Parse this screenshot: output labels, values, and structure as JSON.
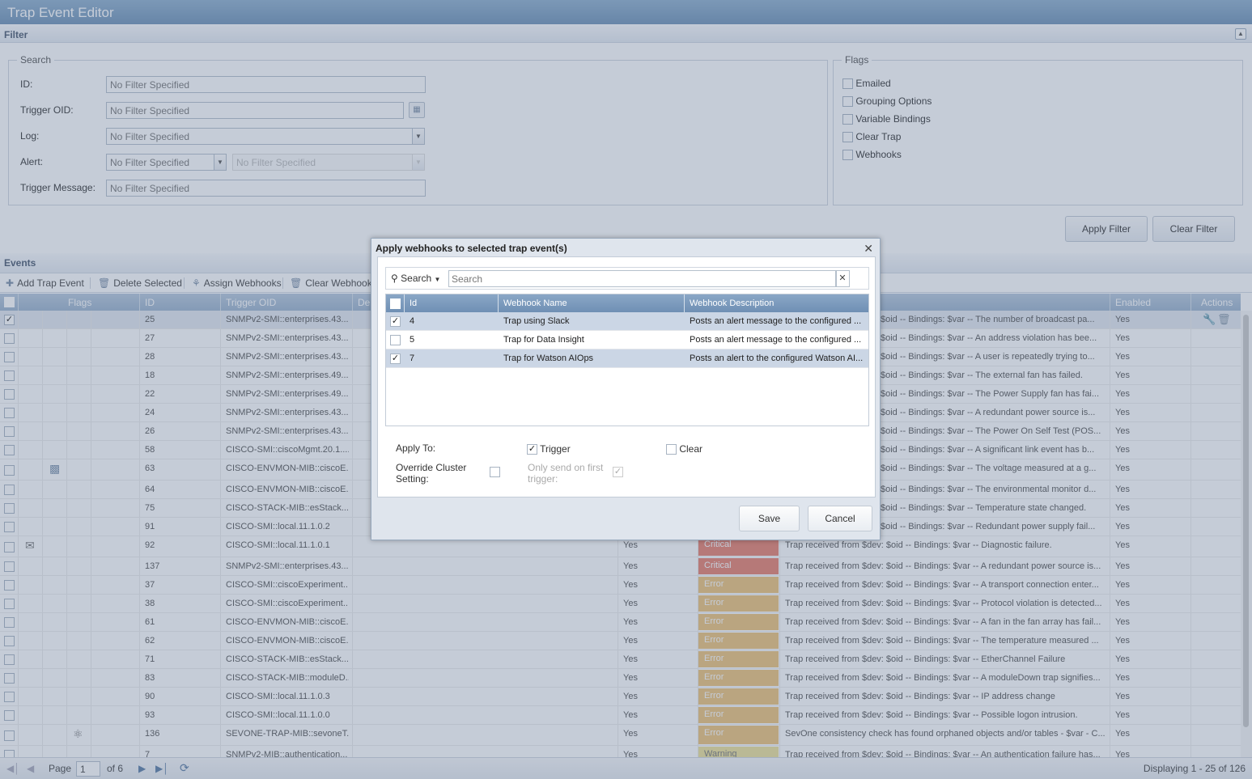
{
  "app": {
    "title": "Trap Event Editor"
  },
  "filter": {
    "title": "Filter",
    "search_legend": "Search",
    "flags_legend": "Flags",
    "fields": [
      {
        "label": "ID:",
        "value": "No Filter Specified"
      },
      {
        "label": "Trigger OID:",
        "value": "No Filter Specified"
      },
      {
        "label": "Log:",
        "value": "No Filter Specified"
      },
      {
        "label": "Alert:",
        "value": "No Filter Specified",
        "value2": "No Filter Specified"
      },
      {
        "label": "Trigger Message:",
        "value": "No Filter Specified"
      }
    ],
    "flags": [
      "Emailed",
      "Grouping Options",
      "Variable Bindings",
      "Clear Trap",
      "Webhooks"
    ],
    "apply_label": "Apply Filter",
    "clear_label": "Clear Filter"
  },
  "events": {
    "title": "Events",
    "toolbar": {
      "add": "Add Trap Event",
      "delete": "Delete Selected",
      "assign": "Assign Webhooks",
      "clear": "Clear Webhooks"
    },
    "columns": {
      "flags": "Flags",
      "id": "ID",
      "oid": "Trigger OID",
      "desc": "De",
      "enabled": "Enabled",
      "actions": "Actions"
    },
    "rows": [
      {
        "id": "25",
        "oid": "SNMPv2-SMI::enterprises.43...",
        "log": "",
        "sev": "",
        "sevclass": "",
        "msg": "$oid -- Bindings: $var -- The number of broadcast pa...",
        "en": "Yes",
        "checked": true,
        "icon": ""
      },
      {
        "id": "27",
        "oid": "SNMPv2-SMI::enterprises.43...",
        "log": "",
        "sev": "",
        "sevclass": "",
        "msg": "$oid -- Bindings: $var -- An address violation has bee...",
        "en": "Yes",
        "checked": false,
        "icon": ""
      },
      {
        "id": "28",
        "oid": "SNMPv2-SMI::enterprises.43...",
        "log": "",
        "sev": "",
        "sevclass": "",
        "msg": "$oid -- Bindings: $var -- A user is repeatedly trying to...",
        "en": "Yes",
        "checked": false,
        "icon": ""
      },
      {
        "id": "18",
        "oid": "SNMPv2-SMI::enterprises.49...",
        "log": "",
        "sev": "",
        "sevclass": "",
        "msg": "$oid -- Bindings: $var -- The external fan has failed.",
        "en": "Yes",
        "checked": false,
        "icon": ""
      },
      {
        "id": "22",
        "oid": "SNMPv2-SMI::enterprises.49...",
        "log": "",
        "sev": "",
        "sevclass": "",
        "msg": "$oid -- Bindings: $var -- The Power Supply fan has fai...",
        "en": "Yes",
        "checked": false,
        "icon": ""
      },
      {
        "id": "24",
        "oid": "SNMPv2-SMI::enterprises.43...",
        "log": "",
        "sev": "",
        "sevclass": "",
        "msg": "$oid -- Bindings: $var -- A redundant power source is...",
        "en": "Yes",
        "checked": false,
        "icon": ""
      },
      {
        "id": "26",
        "oid": "SNMPv2-SMI::enterprises.43...",
        "log": "",
        "sev": "",
        "sevclass": "",
        "msg": "$oid -- Bindings: $var -- The Power On Self Test (POS...",
        "en": "Yes",
        "checked": false,
        "icon": ""
      },
      {
        "id": "58",
        "oid": "CISCO-SMI::ciscoMgmt.20.1....",
        "log": "",
        "sev": "",
        "sevclass": "",
        "msg": "$oid -- Bindings: $var -- A significant link event has b...",
        "en": "Yes",
        "checked": false,
        "icon": ""
      },
      {
        "id": "63",
        "oid": "CISCO-ENVMON-MIB::ciscoE...",
        "log": "",
        "sev": "",
        "sevclass": "",
        "msg": "$oid -- Bindings: $var -- The voltage measured at a g...",
        "en": "Yes",
        "checked": false,
        "icon": "grouping"
      },
      {
        "id": "64",
        "oid": "CISCO-ENVMON-MIB::ciscoE...",
        "log": "",
        "sev": "",
        "sevclass": "",
        "msg": "$oid -- Bindings: $var -- The environmental monitor d...",
        "en": "Yes",
        "checked": false,
        "icon": ""
      },
      {
        "id": "75",
        "oid": "CISCO-STACK-MIB::esStack....",
        "log": "",
        "sev": "",
        "sevclass": "",
        "msg": "$oid -- Bindings: $var -- Temperature state changed.",
        "en": "Yes",
        "checked": false,
        "icon": ""
      },
      {
        "id": "91",
        "oid": "CISCO-SMI::local.11.1.0.2",
        "log": "",
        "sev": "",
        "sevclass": "",
        "msg": "$oid -- Bindings: $var -- Redundant power supply fail...",
        "en": "Yes",
        "checked": false,
        "icon": ""
      },
      {
        "id": "92",
        "oid": "CISCO-SMI::local.11.1.0.1",
        "log": "Yes",
        "sev": "Critical",
        "sevclass": "crit",
        "msg": "Trap received from $dev: $oid -- Bindings: $var -- Diagnostic failure.",
        "en": "Yes",
        "checked": false,
        "icon": "email"
      },
      {
        "id": "137",
        "oid": "SNMPv2-SMI::enterprises.43...",
        "log": "Yes",
        "sev": "Critical",
        "sevclass": "crit",
        "msg": "Trap received from $dev: $oid -- Bindings: $var -- A redundant power source is...",
        "en": "Yes",
        "checked": false,
        "icon": ""
      },
      {
        "id": "37",
        "oid": "CISCO-SMI::ciscoExperiment...",
        "log": "Yes",
        "sev": "Error",
        "sevclass": "err",
        "msg": "Trap received from $dev: $oid -- Bindings: $var -- A transport connection enter...",
        "en": "Yes",
        "checked": false,
        "icon": ""
      },
      {
        "id": "38",
        "oid": "CISCO-SMI::ciscoExperiment...",
        "log": "Yes",
        "sev": "Error",
        "sevclass": "err",
        "msg": "Trap received from $dev: $oid -- Bindings: $var -- Protocol violation is detected...",
        "en": "Yes",
        "checked": false,
        "icon": ""
      },
      {
        "id": "61",
        "oid": "CISCO-ENVMON-MIB::ciscoE...",
        "log": "Yes",
        "sev": "Error",
        "sevclass": "err",
        "msg": "Trap received from $dev: $oid -- Bindings: $var -- A fan in the fan array has fail...",
        "en": "Yes",
        "checked": false,
        "icon": ""
      },
      {
        "id": "62",
        "oid": "CISCO-ENVMON-MIB::ciscoE...",
        "log": "Yes",
        "sev": "Error",
        "sevclass": "err",
        "msg": "Trap received from $dev: $oid -- Bindings: $var -- The temperature measured ...",
        "en": "Yes",
        "checked": false,
        "icon": ""
      },
      {
        "id": "71",
        "oid": "CISCO-STACK-MIB::esStack....",
        "log": "Yes",
        "sev": "Error",
        "sevclass": "err",
        "msg": "Trap received from $dev: $oid -- Bindings: $var -- EtherChannel Failure",
        "en": "Yes",
        "checked": false,
        "icon": ""
      },
      {
        "id": "83",
        "oid": "CISCO-STACK-MIB::moduleD...",
        "log": "Yes",
        "sev": "Error",
        "sevclass": "err",
        "msg": "Trap received from $dev: $oid -- Bindings: $var -- A moduleDown trap signifies...",
        "en": "Yes",
        "checked": false,
        "icon": ""
      },
      {
        "id": "90",
        "oid": "CISCO-SMI::local.11.1.0.3",
        "log": "Yes",
        "sev": "Error",
        "sevclass": "err",
        "msg": "Trap received from $dev: $oid -- Bindings: $var -- IP address change",
        "en": "Yes",
        "checked": false,
        "icon": ""
      },
      {
        "id": "93",
        "oid": "CISCO-SMI::local.11.1.0.0",
        "log": "Yes",
        "sev": "Error",
        "sevclass": "err",
        "msg": "Trap received from $dev: $oid -- Bindings: $var -- Possible logon intrusion.",
        "en": "Yes",
        "checked": false,
        "icon": ""
      },
      {
        "id": "136",
        "oid": "SEVONE-TRAP-MIB::sevoneT...",
        "log": "Yes",
        "sev": "Error",
        "sevclass": "err",
        "msg": "SevOne consistency check has found orphaned objects and/or tables - $var - C...",
        "en": "Yes",
        "checked": false,
        "icon": "bindings"
      },
      {
        "id": "7",
        "oid": "SNMPv2-MIB::authentication...",
        "log": "Yes",
        "sev": "Warning",
        "sevclass": "warn",
        "msg": "Trap received from $dev: $oid -- Bindings: $var -- An authentication failure has...",
        "en": "Yes",
        "checked": false,
        "icon": ""
      }
    ]
  },
  "pager": {
    "page_label": "Page",
    "page": "1",
    "of": "of 6",
    "displaying": "Displaying 1 - 25 of 126"
  },
  "modal": {
    "title": "Apply webhooks to selected trap event(s)",
    "search_label": "Search",
    "search_placeholder": "Search",
    "columns": {
      "id": "Id",
      "name": "Webhook Name",
      "desc": "Webhook Description"
    },
    "rows": [
      {
        "id": "4",
        "name": "Trap using Slack",
        "desc": "Posts an alert message to the configured ...",
        "checked": true
      },
      {
        "id": "5",
        "name": "Trap for Data Insight",
        "desc": "Posts an alert message to the configured ...",
        "checked": false
      },
      {
        "id": "7",
        "name": "Trap for Watson AIOps",
        "desc": "Posts an alert to the configured Watson AI...",
        "checked": true
      }
    ],
    "apply_to": "Apply To:",
    "trigger": "Trigger",
    "clear": "Clear",
    "override": "Override Cluster Setting:",
    "only_first": "Only send on first trigger:",
    "save": "Save",
    "cancel": "Cancel"
  }
}
